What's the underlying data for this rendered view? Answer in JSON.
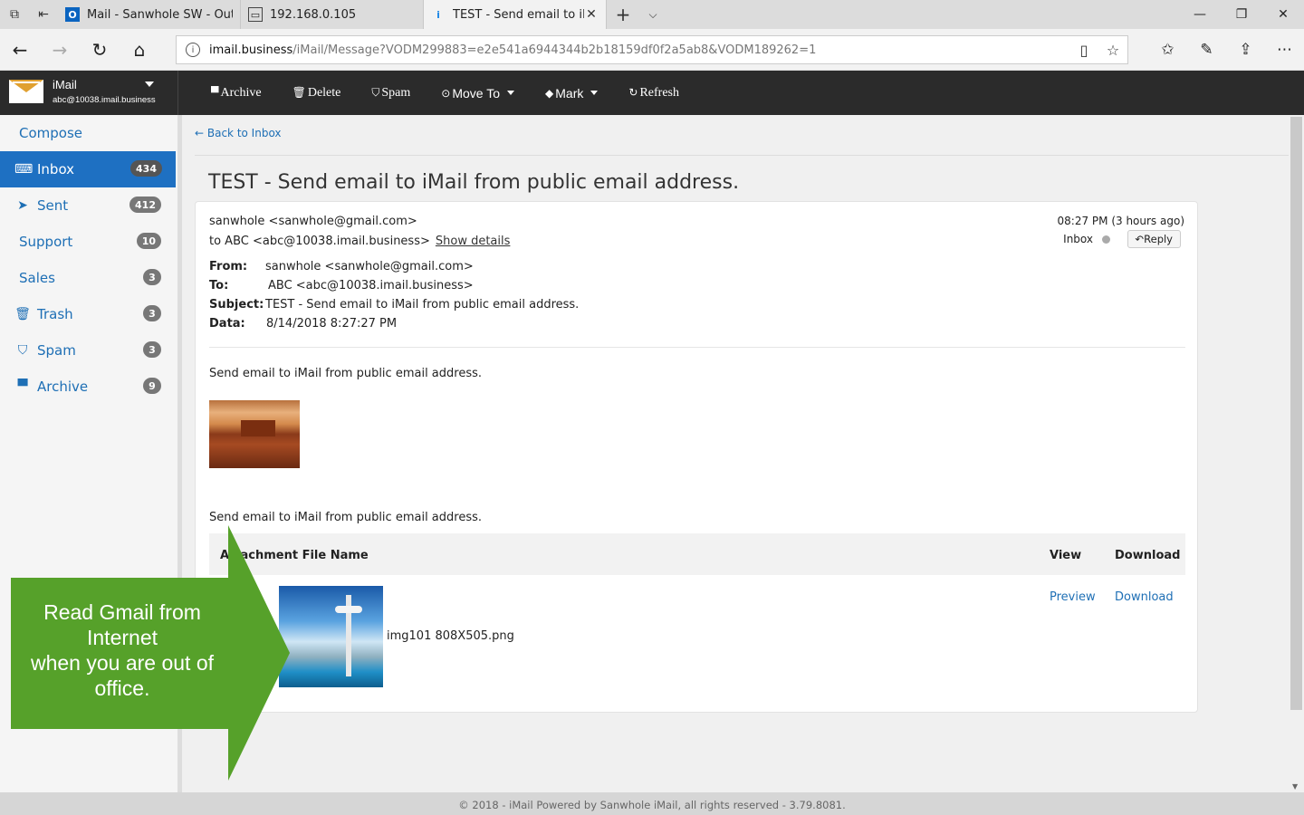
{
  "browser": {
    "tabs": [
      {
        "title": "Mail - Sanwhole SW - Outlo",
        "icon": "outlook-icon"
      },
      {
        "title": "192.168.0.105",
        "icon": "page-icon"
      },
      {
        "title": "TEST - Send email to iM",
        "icon": "imail-icon",
        "active": true
      }
    ],
    "address_host": "imail.business",
    "address_path": "/iMail/Message?VODM299883=e2e541a6944344b2b18159df0f2a5ab8&VODM189262=1"
  },
  "app": {
    "brand_name": "iMail",
    "account": "abc@10038.imail.business",
    "toolbar": {
      "archive": "Archive",
      "delete": "Delete",
      "spam": "Spam",
      "move_to": "Move To",
      "mark": "Mark",
      "refresh": "Refresh"
    }
  },
  "sidebar": {
    "compose": "Compose",
    "folders": [
      {
        "label": "Inbox",
        "count": "434",
        "icon": "inbox-icon"
      },
      {
        "label": "Sent",
        "count": "412",
        "icon": "send-icon"
      },
      {
        "label": "Support",
        "count": "10"
      },
      {
        "label": "Sales",
        "count": "3"
      },
      {
        "label": "Trash",
        "count": "3",
        "icon": "trash-icon"
      },
      {
        "label": "Spam",
        "count": "3",
        "icon": "shield-icon"
      },
      {
        "label": "Archive",
        "count": "9",
        "icon": "archive-icon"
      }
    ]
  },
  "message": {
    "back": "Back to Inbox",
    "subject": "TEST - Send email to iMail from public email address.",
    "sender_line": "sanwhole <sanwhole@gmail.com>",
    "to_line": "to ABC <abc@10038.imail.business>",
    "show_details": "Show details",
    "time": "08:27 PM (3 hours ago)",
    "folder": "Inbox",
    "reply": "Reply",
    "meta": {
      "from_label": "From:",
      "from": "sanwhole <sanwhole@gmail.com>",
      "to_label": "To:",
      "to": "ABC <abc@10038.imail.business>",
      "subject_label": "Subject:",
      "subject": "TEST - Send email to iMail from public email address.",
      "date_label": "Data:",
      "date": "8/14/2018 8:27:27 PM"
    },
    "body_line_1": "Send email to iMail from public email address.",
    "body_line_2": "Send email to iMail from public email address.",
    "attachments": {
      "col_name": "Attachment File Name",
      "col_view": "View",
      "col_download": "Download",
      "file": "img101 808X505.png",
      "preview": "Preview",
      "download": "Download"
    }
  },
  "footer": "© 2018 - iMail Powered by Sanwhole iMail, all rights reserved - 3.79.8081.",
  "callout": "Read Gmail from\nInternet\nwhen you are out of\noffice.",
  "colors": {
    "accent": "#1e70c2",
    "callout": "#56a12a",
    "appbar": "#2b2b2b"
  }
}
